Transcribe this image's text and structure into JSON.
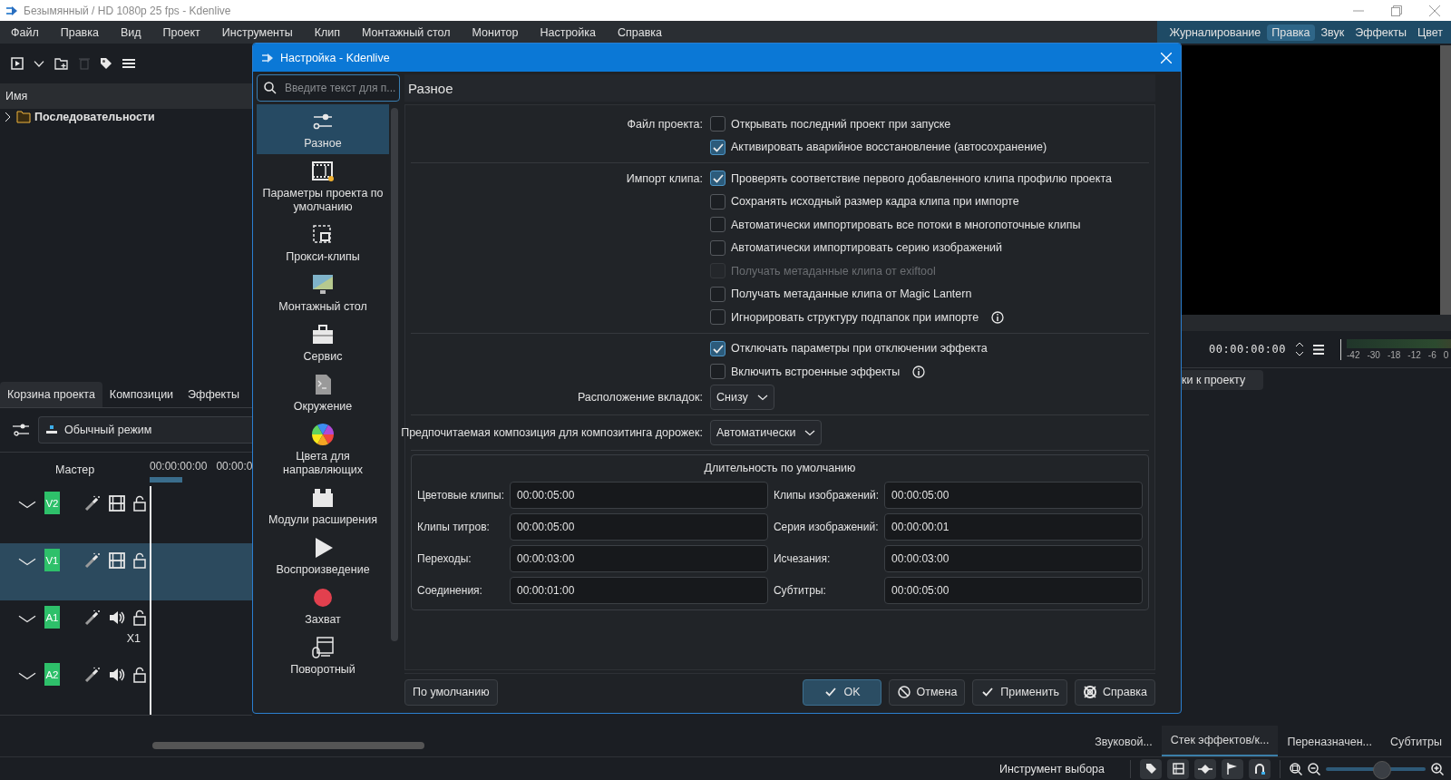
{
  "window": {
    "title": "Безымянный / HD 1080p 25 fps - Kdenlive"
  },
  "menu": [
    "Файл",
    "Правка",
    "Вид",
    "Проект",
    "Инструменты",
    "Клип",
    "Монтажный стол",
    "Монитор",
    "Настройка",
    "Справка"
  ],
  "workspaces": [
    {
      "label": "Журналирование",
      "selected": false
    },
    {
      "label": "Правка",
      "selected": true
    },
    {
      "label": "Звук",
      "selected": false
    },
    {
      "label": "Эффекты",
      "selected": false
    },
    {
      "label": "Цвет",
      "selected": false
    }
  ],
  "project_bin": {
    "column": "Имя",
    "tree": [
      {
        "label": "Последовательности",
        "expanded": false
      }
    ]
  },
  "left_tabs": [
    {
      "label": "Корзина проекта",
      "selected": true
    },
    {
      "label": "Композиции",
      "selected": false
    },
    {
      "label": "Эффекты",
      "selected": false
    }
  ],
  "timeline": {
    "mode": "Обычный режим",
    "master": "Мастер",
    "ruler": [
      "00:00:00:00",
      "00:00:0"
    ],
    "tracks": [
      {
        "name": "V2",
        "kind": "video",
        "selected": false
      },
      {
        "name": "V1",
        "kind": "video",
        "selected": true
      },
      {
        "name": "A1",
        "kind": "audio",
        "selected": false,
        "note": "X1"
      },
      {
        "name": "A2",
        "kind": "audio",
        "selected": false
      }
    ]
  },
  "monitor": {
    "timecode": "00:00:00:00",
    "scale": [
      "-42",
      "-30",
      "-18",
      "-12",
      "-6",
      "0"
    ],
    "tab": "ки к проекту"
  },
  "bottom_tabs": [
    {
      "label": "Звуковой...",
      "selected": false
    },
    {
      "label": "Стек эффектов/к...",
      "selected": true
    },
    {
      "label": "Переназначен...",
      "selected": false
    },
    {
      "label": "Субтитры",
      "selected": false
    }
  ],
  "status_bar": {
    "tool": "Инструмент выбора",
    "zoom": {
      "level": 0.55
    }
  },
  "dialog": {
    "title": "Настройка - Kdenlive",
    "search": {
      "placeholder": "Введите текст для п..."
    },
    "pages": [
      {
        "label": "Разное",
        "kind": "sliders",
        "selected": true
      },
      {
        "label": "Параметры проекта по умолчанию",
        "kind": "film",
        "selected": false
      },
      {
        "label": "Прокси-клипы",
        "kind": "proxy",
        "selected": false
      },
      {
        "label": "Монтажный стол",
        "kind": "monitor",
        "selected": false
      },
      {
        "label": "Сервис",
        "kind": "toolbox",
        "selected": false
      },
      {
        "label": "Окружение",
        "kind": "terminal",
        "selected": false
      },
      {
        "label": "Цвета для направляющих",
        "kind": "colorwheel",
        "selected": false
      },
      {
        "label": "Модули расширения",
        "kind": "plugin",
        "selected": false
      },
      {
        "label": "Воспроизведение",
        "kind": "play",
        "selected": false
      },
      {
        "label": "Захват",
        "kind": "record",
        "selected": false
      },
      {
        "label": "Поворотный",
        "kind": "jog",
        "selected": false
      }
    ],
    "page_title": "Разное",
    "sections": [
      {
        "items": [
          {
            "kind": "checkbox",
            "label": "Файл проекта:",
            "text": "Открывать последний проект при запуске",
            "checked": false,
            "disabled": false,
            "info": false
          },
          {
            "kind": "checkbox",
            "text": "Активировать аварийное восстановление (автосохранение)",
            "checked": true,
            "disabled": false,
            "info": false
          }
        ]
      },
      {
        "items": [
          {
            "kind": "checkbox",
            "label": "Импорт клипа:",
            "text": "Проверять соответствие первого добавленного клипа профилю проекта",
            "checked": true,
            "disabled": false,
            "info": false
          },
          {
            "kind": "checkbox",
            "text": "Сохранять исходный размер кадра клипа при импорте",
            "checked": false,
            "disabled": false,
            "info": false
          },
          {
            "kind": "checkbox",
            "text": "Автоматически импортировать все потоки в многопоточные клипы",
            "checked": false,
            "disabled": false,
            "info": false
          },
          {
            "kind": "checkbox",
            "text": "Автоматически импортировать серию изображений",
            "checked": false,
            "disabled": false,
            "info": false
          },
          {
            "kind": "checkbox",
            "text": "Получать метаданные клипа от exiftool",
            "checked": false,
            "disabled": true,
            "info": false
          },
          {
            "kind": "checkbox",
            "text": "Получать метаданные клипа от Magic Lantern",
            "checked": false,
            "disabled": false,
            "info": false
          },
          {
            "kind": "checkbox",
            "text": "Игнорировать структуру подпапок при импорте",
            "checked": false,
            "disabled": false,
            "info": true
          }
        ]
      },
      {
        "items": [
          {
            "kind": "checkbox",
            "text": "Отключать параметры при отключении эффекта",
            "checked": true,
            "disabled": false,
            "info": false
          },
          {
            "kind": "checkbox",
            "text": "Включить встроенные эффекты",
            "checked": false,
            "disabled": false,
            "info": true
          },
          {
            "kind": "select",
            "label": "Расположение вкладок:",
            "value": "Снизу"
          }
        ]
      },
      {
        "items": [
          {
            "kind": "select",
            "label": "Предпочитаемая композиция для композитинга дорожек:",
            "value": "Автоматически"
          }
        ]
      }
    ],
    "durations": {
      "title": "Длительность по умолчанию",
      "fields": [
        {
          "label": "Цветовые клипы:",
          "value": "00:00:05:00"
        },
        {
          "label": "Клипы изображений:",
          "value": "00:00:05:00"
        },
        {
          "label": "Клипы титров:",
          "value": "00:00:05:00"
        },
        {
          "label": "Серия изображений:",
          "value": "00:00:00:01"
        },
        {
          "label": "Переходы:",
          "value": "00:00:03:00"
        },
        {
          "label": "Исчезания:",
          "value": "00:00:03:00"
        },
        {
          "label": "Соединения:",
          "value": "00:00:01:00"
        },
        {
          "label": "Субтитры:",
          "value": "00:00:05:00"
        }
      ]
    },
    "buttons": [
      {
        "label": "По умолчанию",
        "kind": "defaults"
      },
      {
        "label": "OK",
        "kind": "ok"
      },
      {
        "label": "Отмена",
        "kind": "cancel"
      },
      {
        "label": "Применить",
        "kind": "apply"
      },
      {
        "label": "Справка",
        "kind": "help"
      }
    ]
  }
}
